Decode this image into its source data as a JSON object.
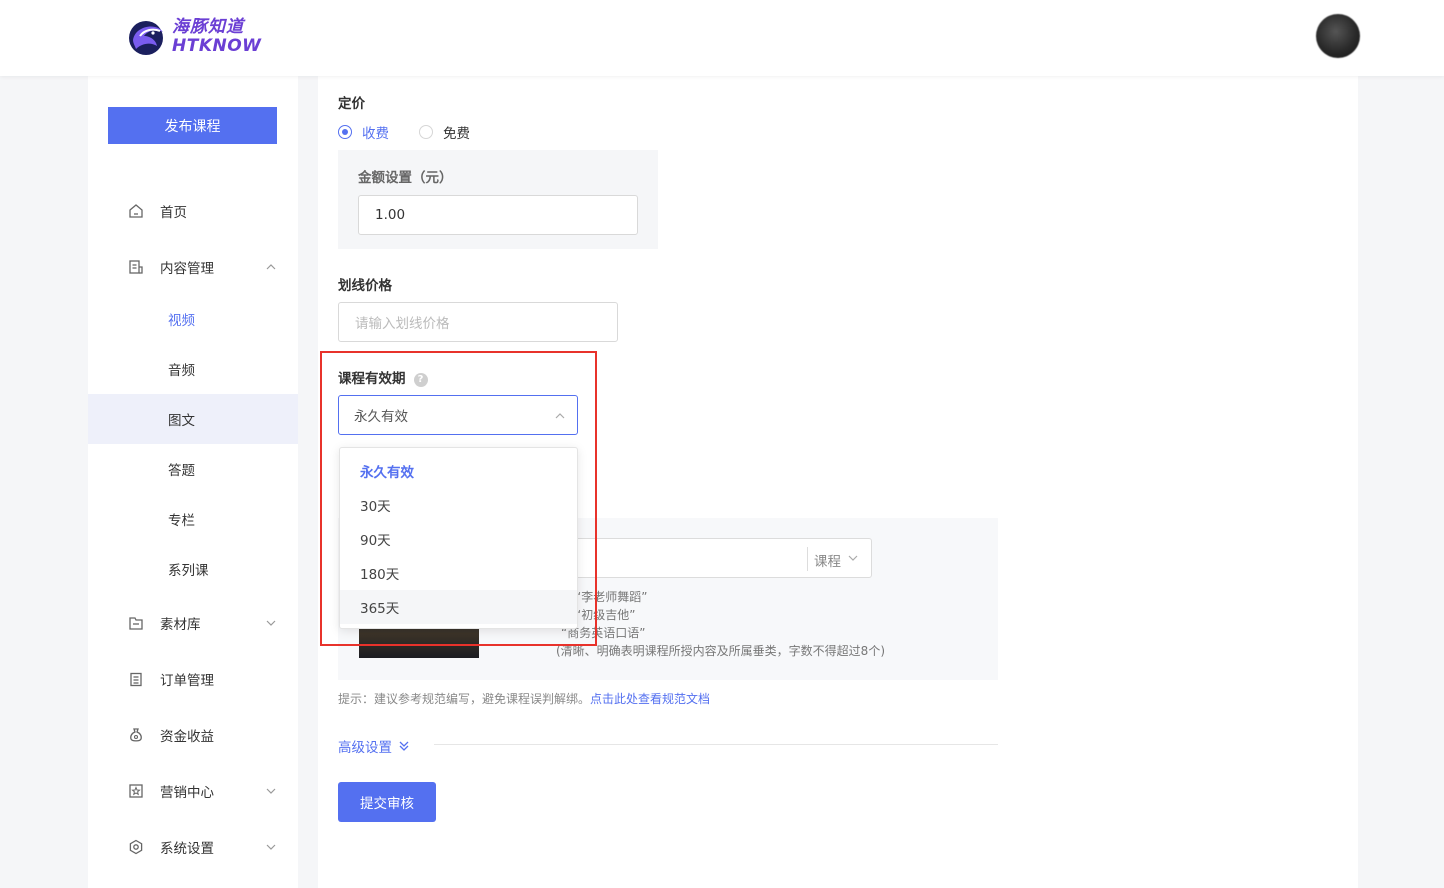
{
  "brand": {
    "name_cn": "海豚知道",
    "name_en": "HTKNOW"
  },
  "sidebar": {
    "publish_label": "发布课程",
    "items": [
      {
        "label": "首页",
        "icon": "home-icon"
      },
      {
        "label": "内容管理",
        "icon": "document-icon",
        "expanded": true
      },
      {
        "label": "素材库",
        "icon": "folder-icon"
      },
      {
        "label": "订单管理",
        "icon": "clipboard-icon"
      },
      {
        "label": "资金收益",
        "icon": "money-bag-icon"
      },
      {
        "label": "营销中心",
        "icon": "star-icon"
      },
      {
        "label": "系统设置",
        "icon": "settings-icon"
      }
    ],
    "sub_items": [
      {
        "label": "视频",
        "state": "active"
      },
      {
        "label": "音频"
      },
      {
        "label": "图文",
        "state": "selected"
      },
      {
        "label": "答题"
      },
      {
        "label": "专栏"
      },
      {
        "label": "系列课"
      }
    ]
  },
  "form": {
    "pricing": {
      "title": "定价",
      "options": [
        {
          "label": "收费",
          "checked": true
        },
        {
          "label": "免费",
          "checked": false
        }
      ],
      "amount_label": "金额设置（元）",
      "amount_value": "1.00"
    },
    "strike_price": {
      "title": "划线价格",
      "placeholder": "请输入划线价格"
    },
    "validity": {
      "title": "课程有效期",
      "help": "?",
      "selected": "永久有效",
      "options": [
        "永久有效",
        "30天",
        "90天",
        "180天",
        "365天"
      ]
    },
    "course_name": {
      "suffix": "课程",
      "tips": [
        "“李老师舞蹈”",
        "“初级吉他”",
        "“商务英语口语”",
        "(清晰、明确表明课程所授内容及所属垂类，字数不得超过8个)"
      ]
    },
    "hint": {
      "text": "提示：建议参考规范编写，避免课程误判解绑。",
      "link": "点击此处查看规范文档"
    },
    "advanced_label": "高级设置",
    "submit_label": "提交审核"
  },
  "colors": {
    "primary": "#5470f0",
    "highlight": "#e8322b",
    "brand": "#6b3fd4"
  }
}
